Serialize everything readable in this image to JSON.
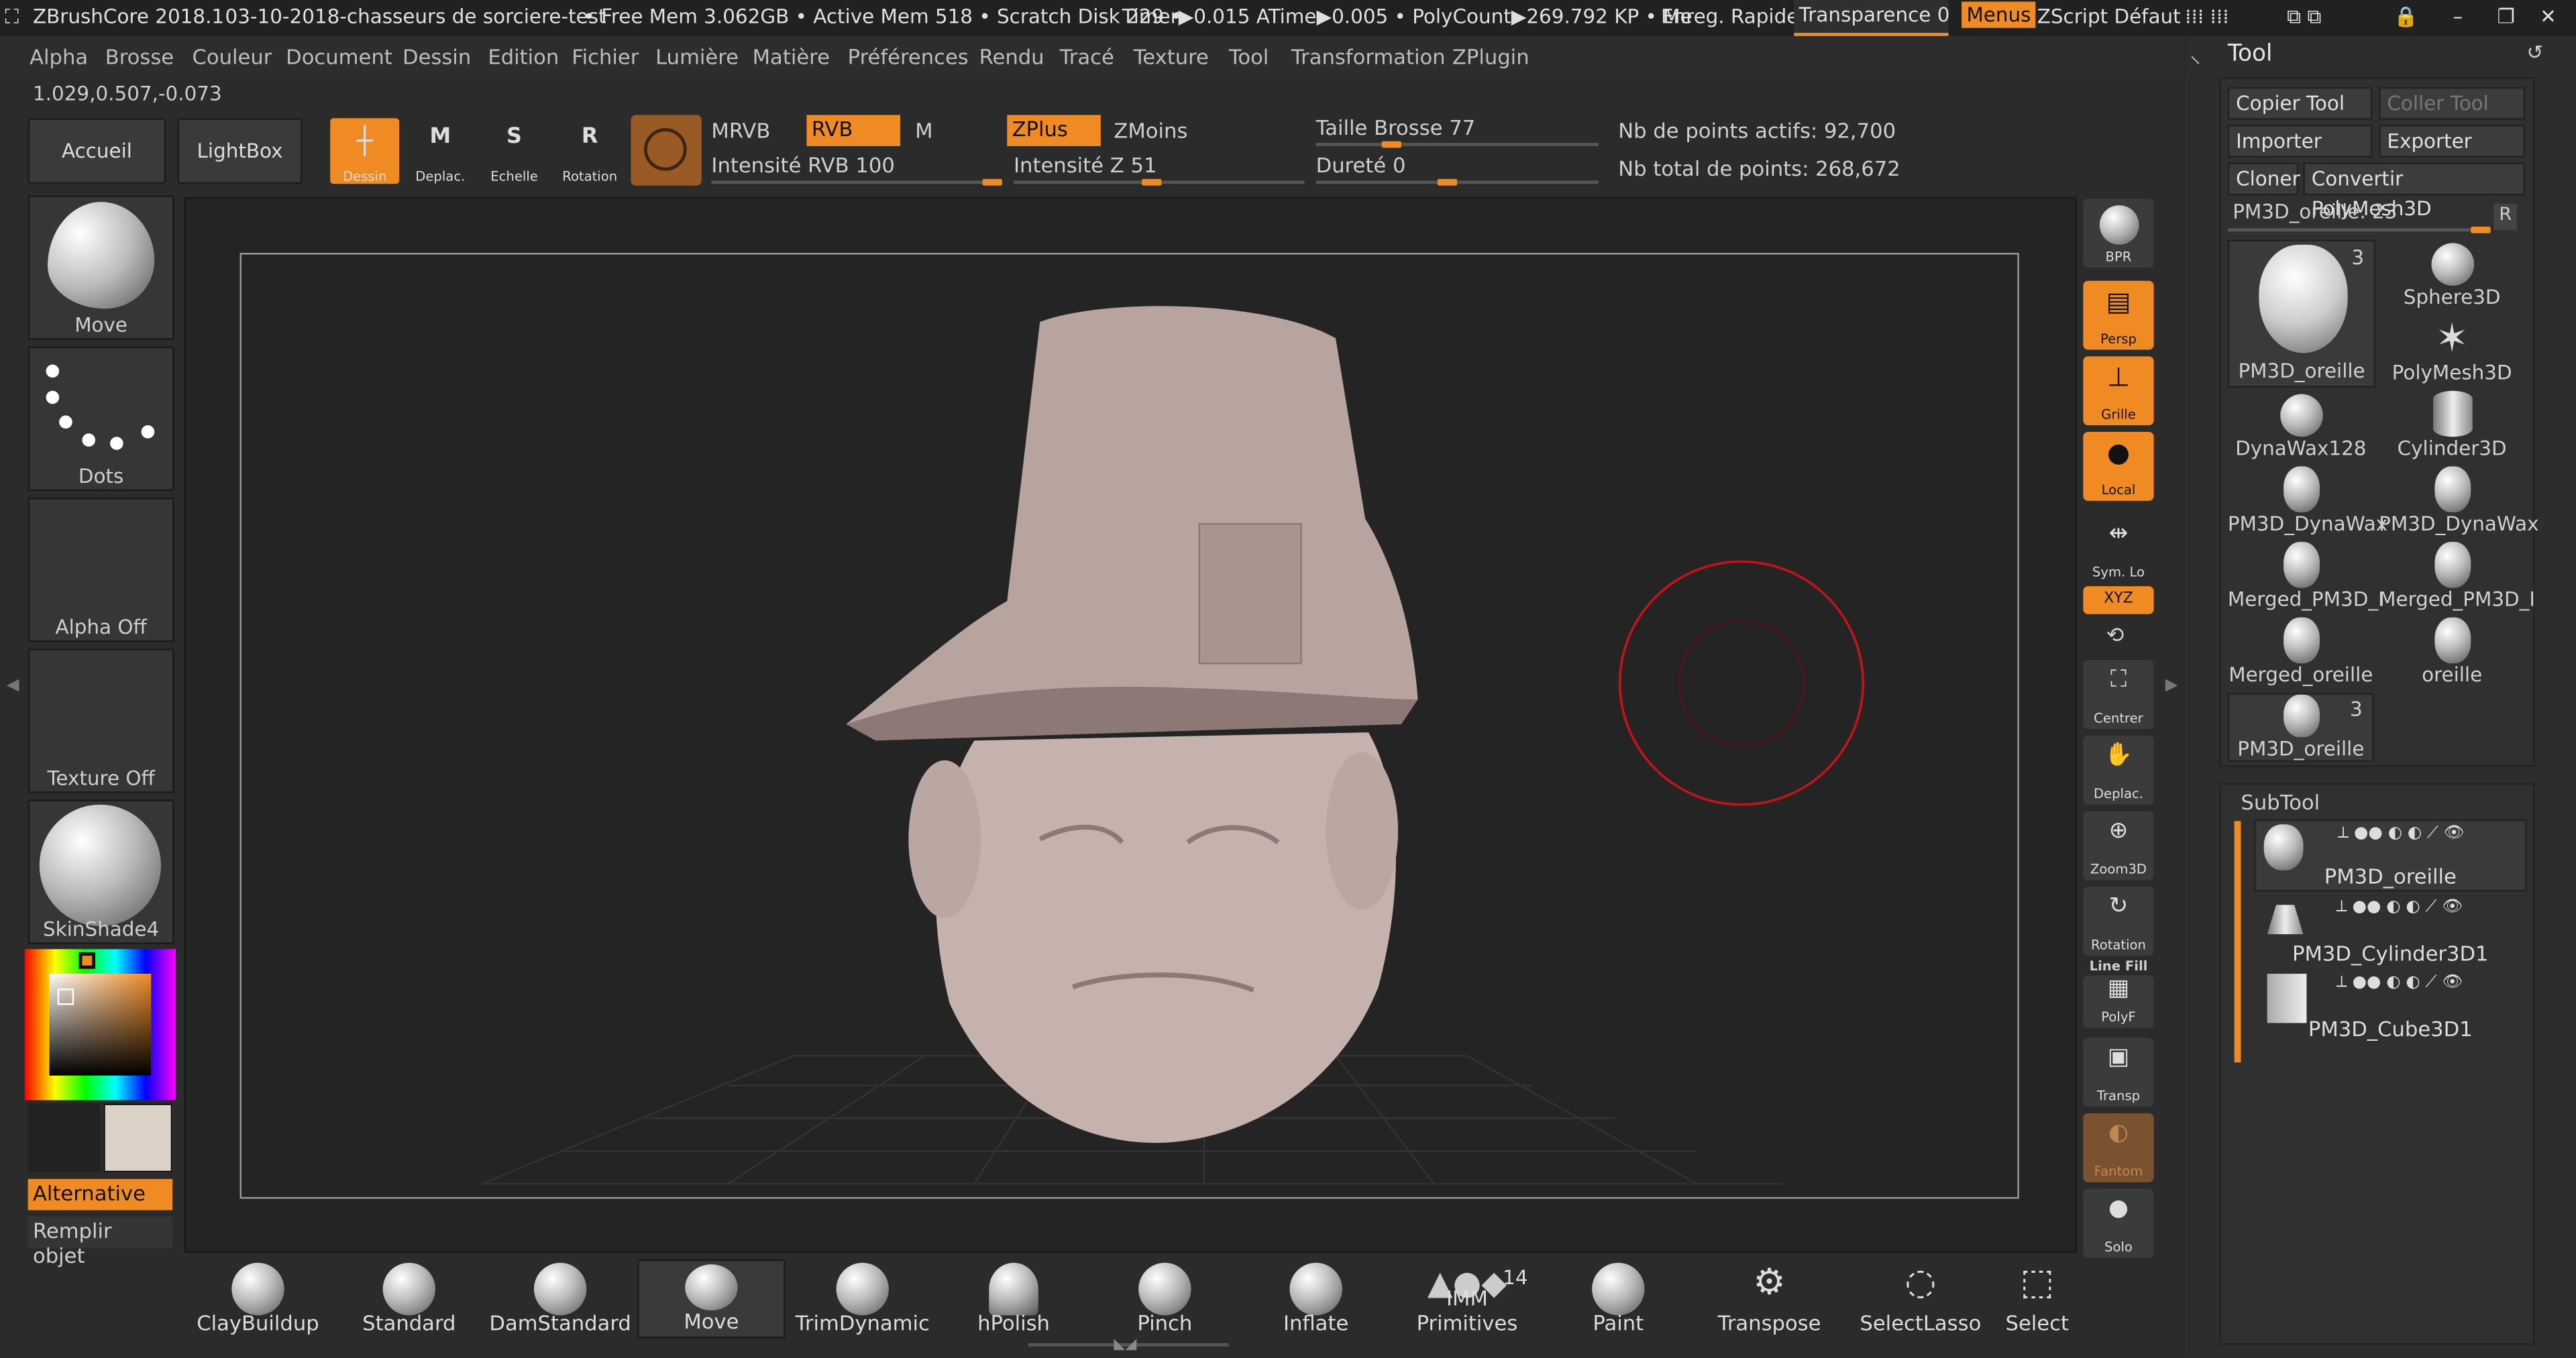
{
  "titlebar": {
    "app": "ZBrushCore 2018.1",
    "doc": "03-10-2018-chasseurs de sorciere-test",
    "mem": "• Free Mem 3.062GB • Active Mem 518 • Scratch Disk 229 •",
    "timer": "Timer▶0.015 ATime▶0.005 • PolyCount▶269.792 KP • Me",
    "save": "Enreg. Rapide",
    "transp": "Transparence 0",
    "menus": "Menus",
    "zscript": "ZScript Défaut"
  },
  "menus": [
    "Alpha",
    "Brosse",
    "Couleur",
    "Document",
    "Dessin",
    "Edition",
    "Fichier",
    "Lumière",
    "Matière",
    "Préférences",
    "Rendu",
    "Tracé",
    "Texture",
    "Tool",
    "Transformation",
    "ZPlugin"
  ],
  "coords": "1.029,0.507,-0.073",
  "toolbar": {
    "home": "Accueil",
    "lightbox": "LightBox",
    "draw": "Dessin",
    "move": "Deplac.",
    "scale": "Echelle",
    "rotate": "Rotation",
    "mrgb": "MRVB",
    "rgb": "RVB",
    "m": "M",
    "zplus": "ZPlus",
    "zminus": "ZMoins",
    "rgb_int_label": "Intensité RVB",
    "rgb_int": "100",
    "z_int_label": "Intensité Z",
    "z_int": "51",
    "brush_size_label": "Taille Brosse",
    "brush_size": "77",
    "hardness_label": "Dureté",
    "hardness": "0",
    "active_points": "Nb de points actifs: 92,700",
    "total_points": "Nb total de points: 268,672",
    "rgb_int_level": 1.0,
    "z_int_level": 0.51,
    "brush_size_level": 0.3,
    "hardness_level": 0.5
  },
  "left": {
    "brush": "Move",
    "stroke": "Dots",
    "alpha": "Alpha Off",
    "texture": "Texture Off",
    "material": "SkinShade4",
    "alt": "Alternative",
    "fill": "Remplir objet"
  },
  "right_tools": [
    {
      "label": "BPR"
    },
    {
      "label": "Persp"
    },
    {
      "label": "Grille"
    },
    {
      "label": "Local"
    },
    {
      "label": "Sym. Lo"
    },
    {
      "label": "XYZ"
    },
    {
      "label": "Centrer"
    },
    {
      "label": "Deplac."
    },
    {
      "label": "Zoom3D"
    },
    {
      "label": "Rotation"
    },
    {
      "label": "Line Fill"
    },
    {
      "label": "PolyF"
    },
    {
      "label": "Transp"
    },
    {
      "label": "Fantom"
    },
    {
      "label": "Solo"
    }
  ],
  "tool_panel": {
    "title": "Tool",
    "copy": "Copier Tool",
    "paste": "Coller Tool",
    "import": "Importer",
    "export": "Exporter",
    "clone": "Cloner",
    "convert": "Convertir PolyMesh3D",
    "current": "PM3D_oreille. 23",
    "r": "R",
    "items": [
      "PM3D_oreille",
      "Sphere3D",
      "PolyMesh3D",
      "DynaWax128",
      "Cylinder3D",
      "PM3D_DynaWax",
      "PM3D_DynaWax",
      "Merged_PM3D_I",
      "Merged_PM3D_I",
      "Merged_oreille",
      "oreille",
      "PM3D_oreille"
    ],
    "count1": "3",
    "count2": "3"
  },
  "subtool": {
    "title": "SubTool",
    "items": [
      "PM3D_oreille",
      "PM3D_Cylinder3D1",
      "PM3D_Cube3D1"
    ]
  },
  "brushes": [
    "ClayBuildup",
    "Standard",
    "DamStandard",
    "Move",
    "TrimDynamic",
    "hPolish",
    "Pinch",
    "Inflate",
    "IMM Primitives",
    "Paint",
    "Transpose",
    "SelectLasso",
    "Select"
  ],
  "imm_count": "14"
}
